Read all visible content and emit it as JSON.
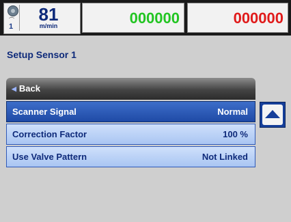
{
  "header": {
    "sensor_number": "1",
    "sensor_mark": "⌒",
    "speed_value": "81",
    "speed_unit": "m/min",
    "counter_good": "000000",
    "counter_bad": "000000"
  },
  "page": {
    "title": "Setup Sensor 1"
  },
  "back": {
    "label": "Back"
  },
  "settings": [
    {
      "label": "Scanner Signal",
      "value": "Normal"
    },
    {
      "label": "Correction Factor",
      "value": "100 %"
    },
    {
      "label": "Use Valve Pattern",
      "value": "Not Linked"
    }
  ],
  "selected_index": 0,
  "colors": {
    "counter_good": "#22c522",
    "counter_bad": "#e01a1a",
    "row_selected": "#2a5bb8",
    "row_normal": "#bcd3f7",
    "title_text": "#0e2a7a"
  },
  "icons": {
    "sensor": "sensor-icon",
    "back": "chevron-left-icon",
    "scroll_up": "arrow-up-icon"
  }
}
